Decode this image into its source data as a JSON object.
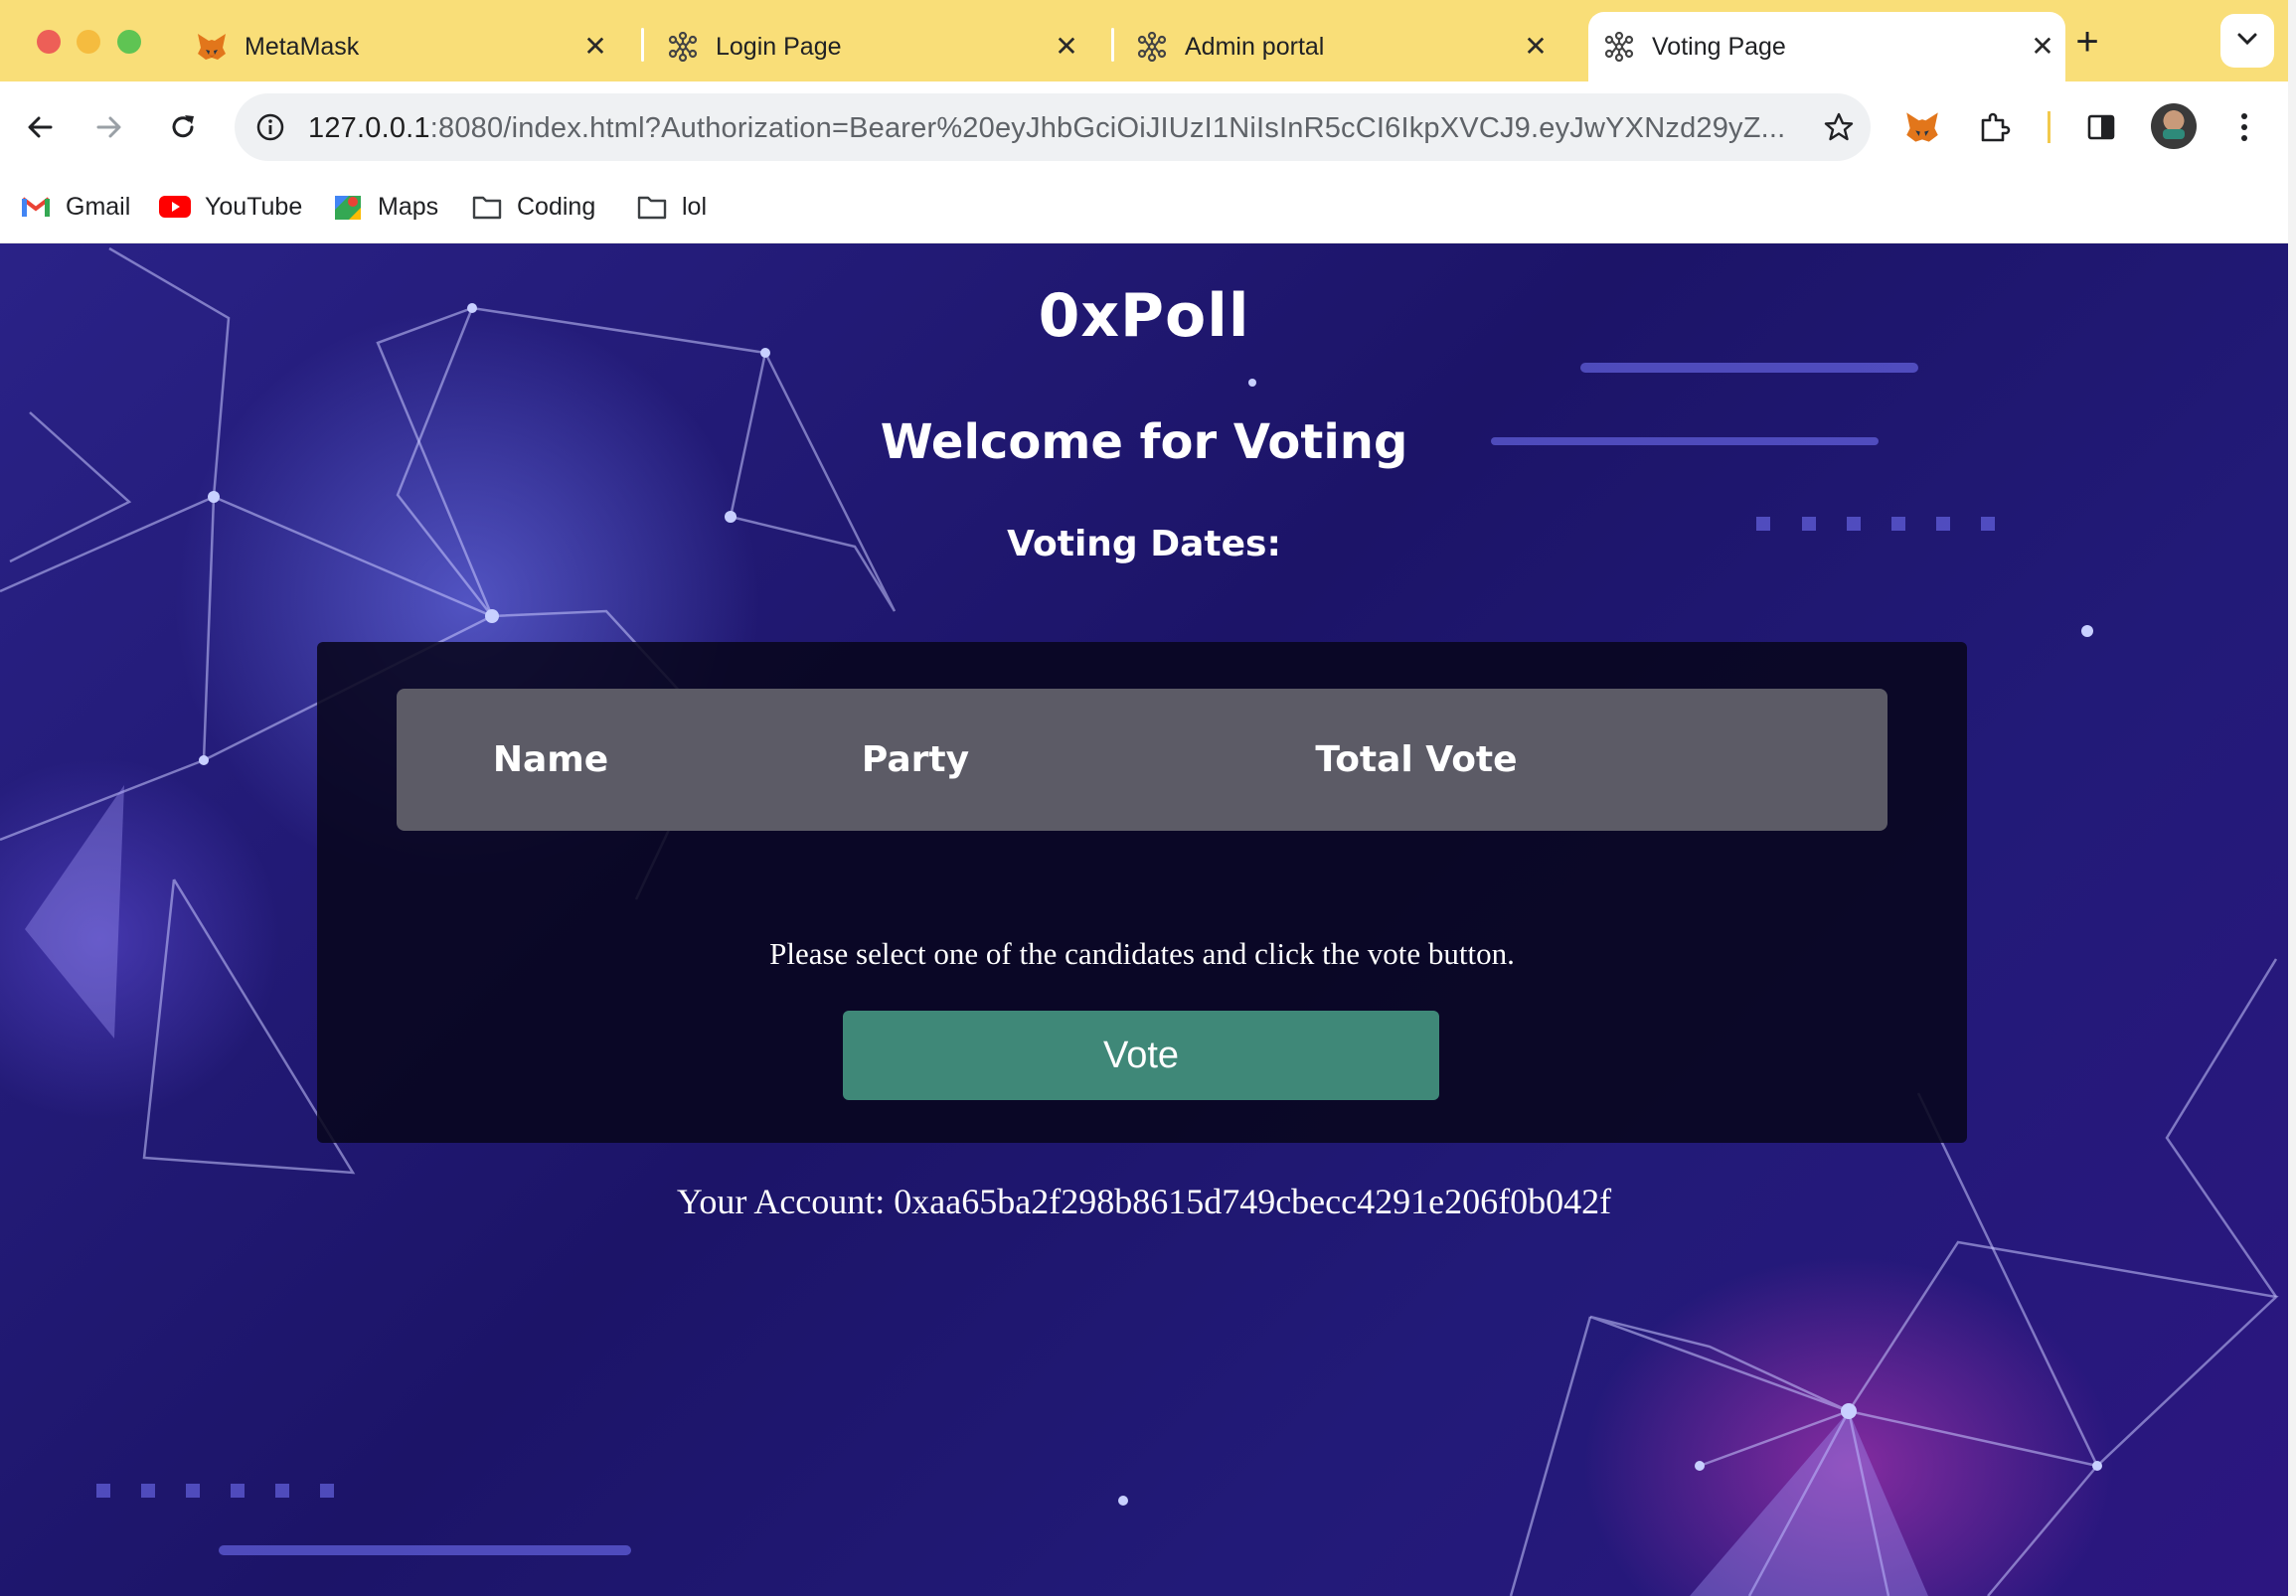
{
  "browser": {
    "tabs": [
      {
        "title": "MetaMask",
        "favicon": "metamask-fox-icon",
        "active": false
      },
      {
        "title": "Login Page",
        "favicon": "network-nodes-icon",
        "active": false
      },
      {
        "title": "Admin portal",
        "favicon": "network-nodes-icon",
        "active": false
      },
      {
        "title": "Voting Page",
        "favicon": "network-nodes-icon",
        "active": true
      }
    ],
    "close_glyph": "✕",
    "new_tab_glyph": "+",
    "address": {
      "host": "127.0.0.1",
      "rest": ":8080/index.html?Authorization=Bearer%20eyJhbGciOiJIUzI1NiIsInR5cCI6IkpXVCJ9.eyJwYXNzd29yZ..."
    },
    "bookmarks": [
      {
        "label": "Gmail",
        "icon": "gmail-icon"
      },
      {
        "label": "YouTube",
        "icon": "youtube-icon"
      },
      {
        "label": "Maps",
        "icon": "maps-icon"
      },
      {
        "label": "Coding",
        "icon": "folder-icon"
      },
      {
        "label": "lol",
        "icon": "folder-icon"
      }
    ],
    "colors": {
      "tabstrip": "#f9de78",
      "active_tab": "#ffffff"
    }
  },
  "page": {
    "app_title": "0xPoll",
    "welcome": "Welcome for Voting",
    "voting_dates_label": "Voting Dates:",
    "table": {
      "columns": [
        "Name",
        "Party",
        "Total Vote"
      ],
      "rows": []
    },
    "instruction": "Please select one of the candidates and click the vote button.",
    "vote_button": "Vote",
    "account_label": "Your Account: 0xaa65ba2f298b8615d749cbecc4291e206f0b042f",
    "colors": {
      "vote_button": "#3f8878",
      "table_header": "#5c5b66",
      "panel": "#08061c"
    }
  }
}
